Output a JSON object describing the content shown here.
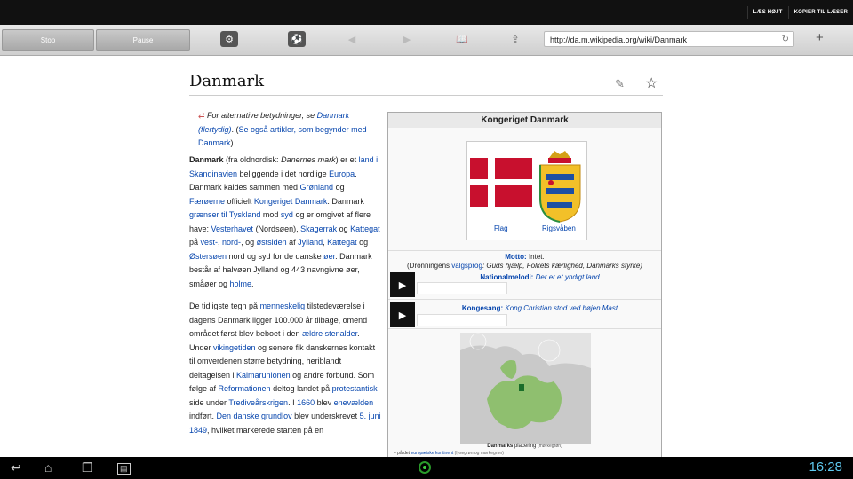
{
  "topbar": {
    "read_aloud": "LÆS HØJT",
    "copy_to_reader": "KOPIER TIL LÆSER"
  },
  "toolbar": {
    "stop_label": "Stop",
    "pause_label": "Pause",
    "url": "http://da.m.wikipedia.org/wiki/Danmark"
  },
  "article": {
    "title": "Danmark",
    "hatnote": {
      "prefix": "For alternative betydninger, se ",
      "link1": "Danmark (flertydig)",
      "mid": ". (",
      "link2": "Se også artikler, som begynder med Danmark",
      "suffix": ")"
    },
    "p1": [
      {
        "t": "Danmark",
        "b": true
      },
      {
        "t": " (fra oldnordisk: "
      },
      {
        "t": "Danernes mark",
        "i": true
      },
      {
        "t": ") er et "
      },
      {
        "t": "land",
        "a": true
      },
      {
        "t": " "
      },
      {
        "t": "i Skandinavien",
        "a": true
      },
      {
        "t": " beliggende i det nordlige "
      },
      {
        "t": "Europa",
        "a": true
      },
      {
        "t": ". Danmark kaldes sammen med "
      },
      {
        "t": "Grønland",
        "a": true
      },
      {
        "t": " og "
      },
      {
        "t": "Færøerne",
        "a": true
      },
      {
        "t": " officielt "
      },
      {
        "t": "Kongeriget Danmark",
        "a": true
      },
      {
        "t": ". Danmark "
      },
      {
        "t": "grænser",
        "a": true
      },
      {
        "t": " "
      },
      {
        "t": "til",
        "a": true
      },
      {
        "t": " "
      },
      {
        "t": "Tyskland",
        "a": true
      },
      {
        "t": " mod "
      },
      {
        "t": "syd",
        "a": true
      },
      {
        "t": " og er omgivet af flere have: "
      },
      {
        "t": "Vesterhavet",
        "a": true
      },
      {
        "t": " (Nordsøen), "
      },
      {
        "t": "Skagerrak",
        "a": true
      },
      {
        "t": " og "
      },
      {
        "t": "Kattegat",
        "a": true
      },
      {
        "t": " på "
      },
      {
        "t": "vest-",
        "a": true
      },
      {
        "t": ", "
      },
      {
        "t": "nord-",
        "a": true
      },
      {
        "t": ", og "
      },
      {
        "t": "østsiden",
        "a": true
      },
      {
        "t": " af "
      },
      {
        "t": "Jylland",
        "a": true
      },
      {
        "t": ", "
      },
      {
        "t": "Kattegat",
        "a": true
      },
      {
        "t": " og "
      },
      {
        "t": "Østersøen",
        "a": true
      },
      {
        "t": " nord og syd for de danske "
      },
      {
        "t": "øer",
        "a": true
      },
      {
        "t": ". Danmark består af halvøen Jylland og 443 navngivne øer, småøer og "
      },
      {
        "t": "holme",
        "a": true
      },
      {
        "t": "."
      }
    ],
    "p2": [
      {
        "t": "De tidligste tegn på "
      },
      {
        "t": "menneskelig",
        "a": true
      },
      {
        "t": " tilstedeværelse i dagens Danmark ligger 100.000 år tilbage, omend området først blev beboet i den "
      },
      {
        "t": "ældre stenalder",
        "a": true
      },
      {
        "t": ". Under "
      },
      {
        "t": "vikingetiden",
        "a": true
      },
      {
        "t": " og senere fik danskernes kontakt til omverdenen større betydning, heriblandt deltagelsen i "
      },
      {
        "t": "Kalmarunionen",
        "a": true
      },
      {
        "t": " og andre forbund. Som følge af "
      },
      {
        "t": "Reformationen",
        "a": true
      },
      {
        "t": " deltog landet på "
      },
      {
        "t": "protestantisk",
        "a": true
      },
      {
        "t": " side under "
      },
      {
        "t": "Trediveårskrigen",
        "a": true
      },
      {
        "t": ". I "
      },
      {
        "t": "1660",
        "a": true
      },
      {
        "t": " blev "
      },
      {
        "t": "enevælden",
        "a": true
      },
      {
        "t": " indført. "
      },
      {
        "t": "Den danske grundlov",
        "a": true
      },
      {
        "t": " blev underskrevet "
      },
      {
        "t": "5. juni 1849",
        "a": true
      },
      {
        "t": ", hvilket markerede starten på en"
      }
    ]
  },
  "infobox": {
    "title": "Kongeriget Danmark",
    "flag_caption": "Flag",
    "coat_caption": "Rigsvåben",
    "motto_label": "Motto:",
    "motto_value": "Intet.",
    "motto_note_prefix": "(Dronningens ",
    "motto_note_link": "valgsprog",
    "motto_note_text": ": Guds hjælp, Folkets kærlighed, Danmarks styrke)",
    "anthem_label": "Nationalmelodi:",
    "anthem_value": "Der er et yndigt land",
    "royal_label": "Kongesang:",
    "royal_value": "Kong Christian stod ved højen Mast",
    "map_caption_bold": "Danmarks",
    "map_caption_rest": "placering",
    "map_caption_small": "(mørkegrøn)",
    "map_note_prefix": "– på det ",
    "map_note_link": "europæiske kontinent",
    "map_note_small": "(lysegrøn og mørkegrøn)"
  },
  "statusbar": {
    "time": "16:28"
  },
  "colors": {
    "link": "#0645ad",
    "clock": "#5ec8ee",
    "flag_red": "#c8102e",
    "map_eu": "#8fbf6f"
  }
}
